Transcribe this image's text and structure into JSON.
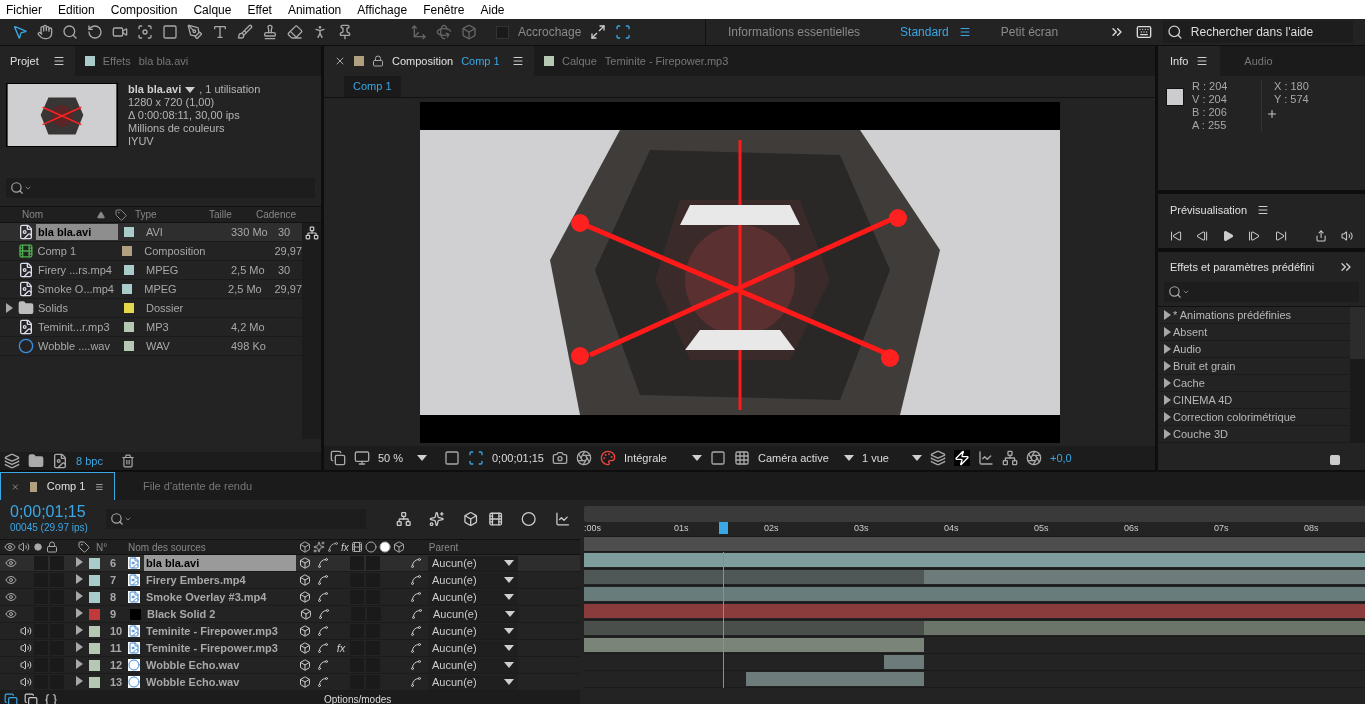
{
  "menu": [
    "Fichier",
    "Edition",
    "Composition",
    "Calque",
    "Effet",
    "Animation",
    "Affichage",
    "Fenêtre",
    "Aide"
  ],
  "toolbar": {
    "snap_label": "Accrochage",
    "snap_on": false,
    "workspaces": [
      {
        "label": "Informations essentielles",
        "selected": false
      },
      {
        "label": "Standard",
        "selected": true
      },
      {
        "label": "Petit écran",
        "selected": false
      }
    ],
    "help_placeholder": "Rechercher dans l'aide"
  },
  "project": {
    "tabs": [
      {
        "label": "Projet",
        "selected": true
      },
      {
        "label": "Effets",
        "sublabel": "bla bla.avi",
        "selected": false
      }
    ],
    "info": {
      "name": "bla bla.avi",
      "usage": ", 1 utilisation",
      "lines": [
        "1280 x 720 (1,00)",
        "Δ 0:00:08:11, 30,00 ips",
        "Millions de couleurs",
        "IYUV"
      ]
    },
    "columns": [
      "Nom",
      "Type",
      "Taille",
      "Cadence"
    ],
    "rows": [
      {
        "kind": "file",
        "name": "bla bla.avi",
        "type": "AVI",
        "size": "330 Mo",
        "rate": "30",
        "color": "#a9cccb",
        "selected": true
      },
      {
        "kind": "comp",
        "name": "Comp 1",
        "type": "Composition",
        "size": "",
        "rate": "29,97",
        "color": "#b0a080",
        "selected": false
      },
      {
        "kind": "file",
        "name": "Firery ...rs.mp4",
        "type": "MPEG",
        "size": "2,5 Mo",
        "rate": "30",
        "color": "#a9cccb",
        "selected": false
      },
      {
        "kind": "file",
        "name": "Smoke O...mp4",
        "type": "MPEG",
        "size": "2,5 Mo",
        "rate": "29,97",
        "color": "#a9cccb",
        "selected": false
      },
      {
        "kind": "folder",
        "name": "Solids",
        "type": "Dossier",
        "size": "",
        "rate": "",
        "color": "#e3d94a",
        "selected": false
      },
      {
        "kind": "file",
        "name": "Teminit...r.mp3",
        "type": "MP3",
        "size": "4,2 Mo",
        "rate": "",
        "color": "#b5c8b3",
        "selected": false
      },
      {
        "kind": "audio",
        "name": "Wobble ....wav",
        "type": "WAV",
        "size": "498 Ko",
        "rate": "",
        "color": "#b5c8b3",
        "selected": false
      }
    ],
    "bpc": "8 bpc"
  },
  "viewer": {
    "tabs": [
      {
        "label": "Composition",
        "sublabel": "Comp 1",
        "color": "#b0a080",
        "selected": true
      },
      {
        "label": "Calque",
        "sublabel": "Teminite - Firepower.mp3",
        "color": "#b5c8b3",
        "selected": false
      }
    ],
    "crumb": "Comp 1",
    "zoom": "50 %",
    "timecode": "0;00;01;15",
    "resolution": "Intégrale",
    "camera": "Caméra active",
    "views": "1 vue",
    "exposure": "+0,0"
  },
  "info_panel": {
    "tabs": [
      {
        "label": "Info",
        "selected": true
      },
      {
        "label": "Audio",
        "selected": false
      }
    ],
    "color": "#cccccf",
    "channels": [
      "R : 204",
      "V : 204",
      "B : 206",
      "A : 255"
    ],
    "coords": [
      "X : 180",
      "Y : 574"
    ]
  },
  "preview": {
    "title": "Prévisualisation"
  },
  "effects": {
    "title": "Effets et paramètres prédéfini",
    "items": [
      "* Animations prédéfinies",
      "Absent",
      "Audio",
      "Bruit et grain",
      "Cache",
      "CINEMA 4D",
      "Correction colorimétrique",
      "Couche 3D"
    ]
  },
  "timeline": {
    "tabs": [
      {
        "label": "Comp 1",
        "color": "#b0a080",
        "selected": true
      },
      {
        "label": "File d'attente de rendu",
        "selected": false
      }
    ],
    "timecode": "0;00;01;15",
    "frames": "00045 (29.97 ips)",
    "columns": [
      "N°",
      "Nom des sources",
      "Parent"
    ],
    "fx_header": "fx",
    "ticks": [
      ":00s",
      "01s",
      "02s",
      "03s",
      "04s",
      "05s",
      "06s",
      "07s",
      "08s"
    ],
    "layers": [
      {
        "kind": "video",
        "number": "6",
        "name": "bla bla.avi",
        "color": "#a9cccb",
        "selected": true,
        "parent": "Aucun(e)"
      },
      {
        "kind": "video",
        "number": "7",
        "name": "Firery Embers.mp4",
        "color": "#a9cccb",
        "selected": false,
        "parent": "Aucun(e)"
      },
      {
        "kind": "video",
        "number": "8",
        "name": "Smoke Overlay #3.mp4",
        "color": "#a9cccb",
        "selected": false,
        "parent": "Aucun(e)"
      },
      {
        "kind": "solid",
        "number": "9",
        "name": "Black Solid 2",
        "color": "#c03a3a",
        "selected": false,
        "parent": "Aucun(e)"
      },
      {
        "kind": "audio",
        "number": "10",
        "name": "Teminite - Firepower.mp3",
        "color": "#b5c8b3",
        "selected": false,
        "parent": "Aucun(e)"
      },
      {
        "kind": "audio",
        "number": "11",
        "name": "Teminite - Firepower.mp3",
        "color": "#b5c8b3",
        "selected": false,
        "fx": "fx",
        "parent": "Aucun(e)"
      },
      {
        "kind": "wav",
        "number": "12",
        "name": "Wobble Echo.wav",
        "color": "#b5c8b3",
        "selected": false,
        "parent": "Aucun(e)"
      },
      {
        "kind": "wav",
        "number": "13",
        "name": "Wobble Echo.wav",
        "color": "#b5c8b3",
        "selected": false,
        "parent": "Aucun(e)"
      }
    ],
    "options_label": "Options/modes"
  }
}
